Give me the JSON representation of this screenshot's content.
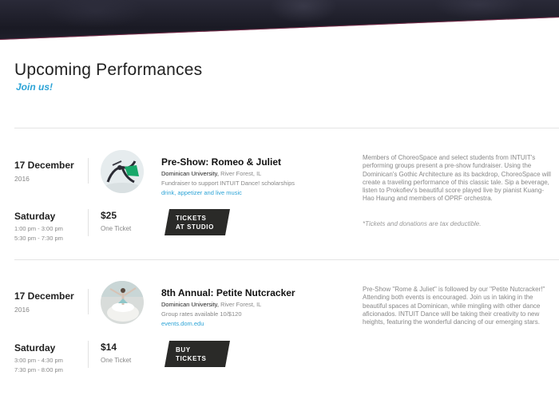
{
  "section": {
    "title": "Upcoming Performances",
    "subtitle": "Join us!"
  },
  "events": [
    {
      "date": "17 December",
      "year": "2016",
      "day": "Saturday",
      "times": [
        "1:00 pm - 3:00 pm",
        "5:30 pm - 7:30 pm"
      ],
      "title": "Pre-Show: Romeo & Juliet",
      "venue": "Dominican University,",
      "location": "River Forest, IL",
      "note": "Fundraiser to support INTUIT Dance! scholarships",
      "link": "drink, appetizer and live music",
      "price": "$25",
      "price_note": "One Ticket",
      "button": [
        "TICKETS",
        "AT STUDIO"
      ],
      "description": "Members of ChoreoSpace and select students from INTUIT's performing groups present a pre-show fundraiser. Using the Dominican's Gothic Architecture as its backdrop, ChoreoSpace will create a traveling performance of this classic tale. Sip a beverage, listen to Prokofiev's beautiful score played live by pianist Kuang-Hao Haung and members of OPRF orchestra.",
      "description_note": "*Tickets and donations are tax deductible."
    },
    {
      "date": "17 December",
      "year": "2016",
      "day": "Saturday",
      "times": [
        "3:00 pm - 4:30 pm",
        "7:30 pm - 8:00 pm"
      ],
      "title": "8th Annual: Petite Nutcracker",
      "venue": "Dominican University,",
      "location": "River Forest, IL",
      "note": "Group rates available 10/$120",
      "link": "events.dom.edu",
      "price": "$14",
      "price_note": "One Ticket",
      "button": [
        "BUY",
        "TICKETS"
      ],
      "description": "Pre-Show \"Rome & Juliet\" is followed by our \"Petite Nutcracker!\" Attending both events is encouraged. Join us in taking in the beautiful spaces at Dominican, while mingling with other dance aficionados. INTUIT Dance will be taking their creativity to new heights, featuring the wonderful dancing of our emerging stars."
    }
  ]
}
